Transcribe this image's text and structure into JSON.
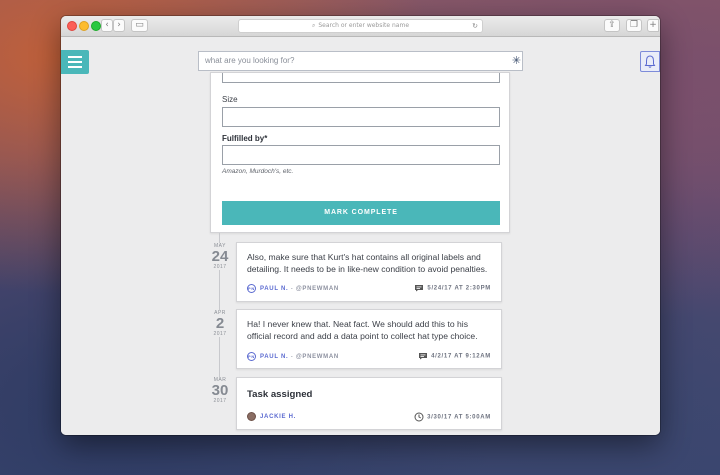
{
  "browser": {
    "url_placeholder": "Search or enter website name",
    "search_glyph": "⌕",
    "reload_glyph": "↻",
    "back_glyph": "‹",
    "forward_glyph": "›",
    "sidebar_glyph": "▭",
    "share_glyph": "⇪",
    "tabs_glyph": "❐",
    "newtab_glyph": "+"
  },
  "app": {
    "search_placeholder": "what are you looking for?",
    "spinner_glyph": "✳",
    "accent_color": "#4ab7b9",
    "link_color": "#5b6ad0"
  },
  "form": {
    "size_label": "Size",
    "fulfilled_label": "Fulfilled by*",
    "fulfilled_hint": "Amazon, Murdoch's, etc.",
    "submit_label": "MARK COMPLETE"
  },
  "timeline": [
    {
      "month": "MAY",
      "day": "24",
      "year": "2017",
      "text": "Also, make sure that Kurt's hat contains all original labels and detailing. It needs to be in like-new condition to avoid penalties.",
      "author": "PAUL N.",
      "sep": "-",
      "handle": "@PNEWMAN",
      "avatar": "PN",
      "timestamp": "5/24/17 AT 2:30PM",
      "stamp_icon": "comment-icon"
    },
    {
      "month": "APR",
      "day": "2",
      "year": "2017",
      "text": "Ha! I never knew that. Neat fact. We should add this to his official record and add a data point to collect hat type choice.",
      "author": "PAUL N.",
      "sep": "-",
      "handle": "@PNEWMAN",
      "avatar": "PN",
      "timestamp": "4/2/17 AT 9:12AM",
      "stamp_icon": "comment-icon"
    },
    {
      "month": "MAR",
      "day": "30",
      "year": "2017",
      "title": "Task assigned",
      "author": "JACKIE H.",
      "timestamp": "3/30/17 AT 5:00AM",
      "stamp_icon": "clock-icon"
    }
  ]
}
